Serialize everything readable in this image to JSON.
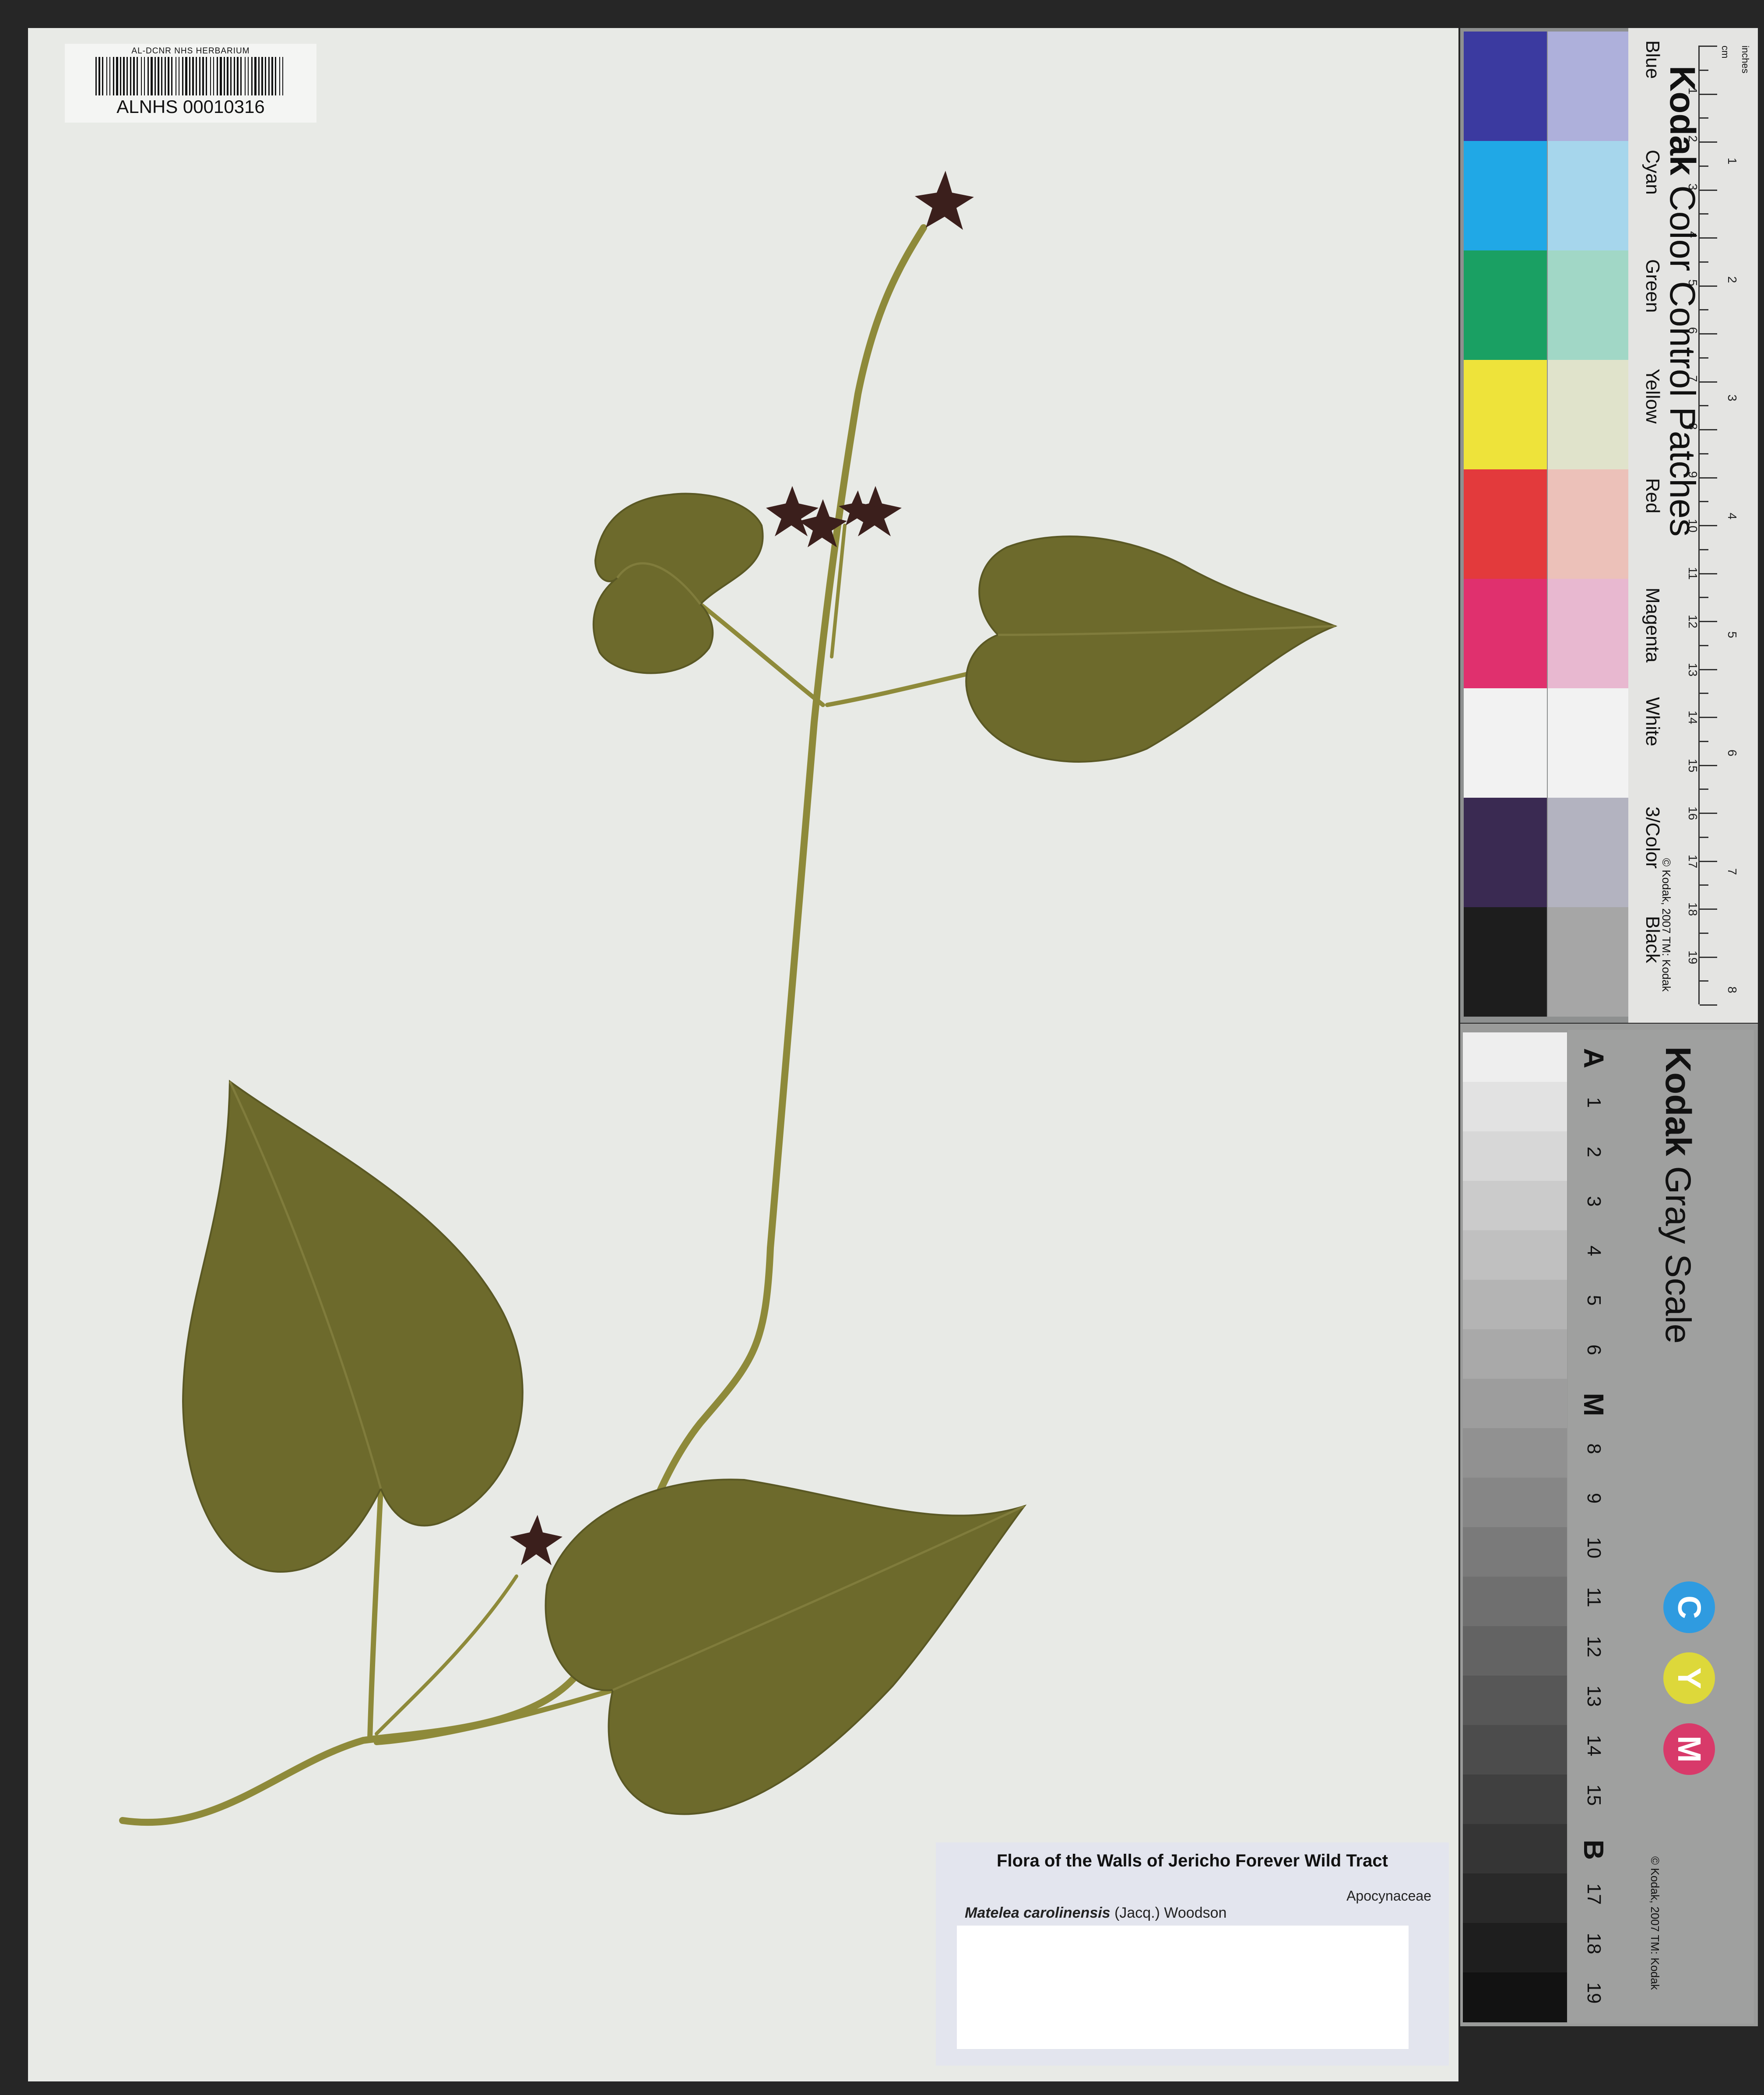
{
  "barcode": {
    "institution": "AL-DCNR NHS HERBARIUM",
    "number": "ALNHS 00010316"
  },
  "color_card": {
    "brand": "Kodak",
    "title": "Color Control Patches",
    "patches": [
      {
        "name": "Blue",
        "dark": "#3b3aa0",
        "light": "#aeb0db"
      },
      {
        "name": "Cyan",
        "dark": "#20a8e6",
        "light": "#a6d6ec"
      },
      {
        "name": "Green",
        "dark": "#1aa063",
        "light": "#a1d7c6"
      },
      {
        "name": "Yellow",
        "dark": "#eee33a",
        "light": "#e0e3cb"
      },
      {
        "name": "Red",
        "dark": "#e33a3c",
        "light": "#ecc1b9"
      },
      {
        "name": "Magenta",
        "dark": "#e0306e",
        "light": "#e8b8d0"
      },
      {
        "name": "White",
        "dark": "#f2f2f2",
        "light": "#f2f2f2"
      },
      {
        "name": "3/Color",
        "dark": "#3a2a52",
        "light": "#b3b3c0"
      },
      {
        "name": "Black",
        "dark": "#1d1d1d",
        "light": "#a6a6a6"
      }
    ],
    "copyright": "© Kodak, 2007 TM: Kodak",
    "ruler_units": {
      "cm": "cm",
      "inches": "inches"
    },
    "cm_marks": [
      "1",
      "2",
      "3",
      "4",
      "5",
      "6",
      "7",
      "8",
      "9",
      "10",
      "11",
      "12",
      "13",
      "14",
      "15",
      "16",
      "17",
      "18",
      "19"
    ],
    "inch_marks": [
      "1",
      "2",
      "3",
      "4",
      "5",
      "6",
      "7",
      "8"
    ]
  },
  "gray_scale": {
    "brand": "Kodak",
    "title": "Gray Scale",
    "steps": [
      "A",
      "1",
      "2",
      "3",
      "4",
      "5",
      "6",
      "M",
      "8",
      "9",
      "10",
      "11",
      "12",
      "13",
      "14",
      "15",
      "B",
      "17",
      "18",
      "19"
    ],
    "cym": [
      "C",
      "Y",
      "M"
    ],
    "copyright": "© Kodak, 2007 TM: Kodak"
  },
  "label": {
    "title": "Flora of  the Walls of Jericho Forever Wild Tract",
    "family": "Apocynaceae",
    "genus_species": "Matelea carolinensis",
    "authority": "(Jacq.) Woodson"
  }
}
